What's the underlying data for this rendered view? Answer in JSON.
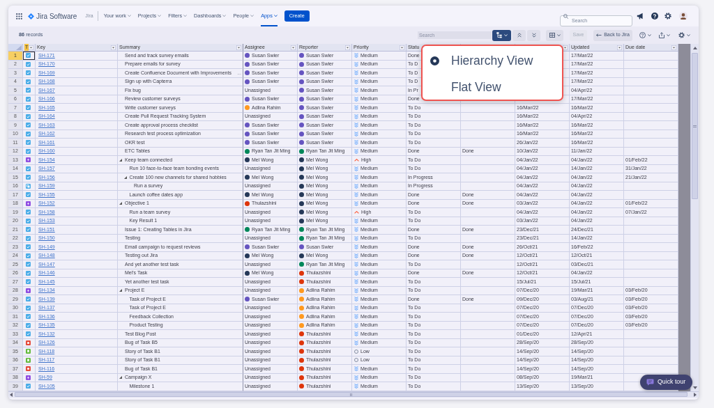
{
  "nav": {
    "product": "Jira Software",
    "site": "Jira",
    "items": [
      {
        "label": "Your work",
        "selected": false
      },
      {
        "label": "Projects",
        "selected": false
      },
      {
        "label": "Filters",
        "selected": false
      },
      {
        "label": "Dashboards",
        "selected": false
      },
      {
        "label": "People",
        "selected": false
      },
      {
        "label": "Apps",
        "selected": true
      }
    ],
    "create_button": "Create",
    "search": {
      "placeholder": "Search"
    }
  },
  "toolbar": {
    "records": "**86** records",
    "search": {
      "placeholder": "Search"
    },
    "view_button": {
      "open": true
    },
    "save_button": {
      "label": "Save",
      "disabled": true
    },
    "back_button": "Back to Jira"
  },
  "table": {
    "columns": [
      {
        "label": "T",
        "selected": true
      },
      {
        "label": "Key",
        "selected": false
      },
      {
        "label": "Summary",
        "selected": false
      },
      {
        "label": "Assignee",
        "selected": false
      },
      {
        "label": "Reporter",
        "selected": false
      },
      {
        "label": "Priority",
        "selected": false
      },
      {
        "label": "Statu",
        "selected": false
      },
      {
        "label": "Updated",
        "selected": false
      },
      {
        "label": "Due date",
        "selected": false
      }
    ],
    "rows": [
      {
        "num": "1",
        "selected": true,
        "kind": "task",
        "key": "SH-171",
        "summary": "Send and track survey emails",
        "assignee": {
          "name": "Susan Swier",
          "color": "#6554c0"
        },
        "reporter": {
          "name": "Susan Swier",
          "color": "#6554c0"
        },
        "priority": {
          "label": "Medium",
          "kind": "medium"
        },
        "status": "Done",
        "updated": "17/Mar/22"
      },
      {
        "num": "2",
        "selected": false,
        "kind": "task",
        "key": "SH-170",
        "summary": "Prepare emails for survey",
        "assignee": {
          "name": "Susan Swier",
          "color": "#6554c0"
        },
        "reporter": {
          "name": "Susan Swier",
          "color": "#6554c0"
        },
        "priority": {
          "label": "Medium",
          "kind": "medium"
        },
        "status": "To D",
        "updated": "17/Mar/22"
      },
      {
        "num": "3",
        "selected": false,
        "kind": "task",
        "key": "SH-169",
        "summary": "Create Confluence Document with Improvements",
        "note": "...",
        "assignee": {
          "name": "Susan Swier",
          "color": "#6554c0"
        },
        "reporter": {
          "name": "Susan Swier",
          "color": "#6554c0"
        },
        "priority": {
          "label": "Medium",
          "kind": "medium"
        },
        "status": "To D",
        "updated": "17/Mar/22"
      },
      {
        "num": "4",
        "selected": false,
        "kind": "task",
        "key": "SH-168",
        "summary": "Sign up with Capterra",
        "assignee": {
          "name": "Susan Swier",
          "color": "#6554c0"
        },
        "reporter": {
          "name": "Susan Swier",
          "color": "#6554c0"
        },
        "priority": {
          "label": "Medium",
          "kind": "medium"
        },
        "status": "To D",
        "updated": "17/Mar/22"
      },
      {
        "num": "5",
        "selected": false,
        "kind": "task",
        "key": "SH-167",
        "summary": "Fix bug",
        "assignee": {
          "name": "Unassigned"
        },
        "reporter": {
          "name": "Susan Swier",
          "color": "#6554c0"
        },
        "priority": {
          "label": "Medium",
          "kind": "medium"
        },
        "status": "In Pr",
        "updated": "04/Apr/22"
      },
      {
        "num": "6",
        "selected": false,
        "kind": "task",
        "key": "SH-166",
        "summary": "Review customer surveys",
        "assignee": {
          "name": "Susan Swier",
          "color": "#6554c0"
        },
        "reporter": {
          "name": "Susan Swier",
          "color": "#6554c0"
        },
        "priority": {
          "label": "Medium",
          "kind": "medium"
        },
        "status": "Done",
        "updated": "17/Mar/22"
      },
      {
        "num": "7",
        "selected": false,
        "kind": "task",
        "key": "SH-165",
        "summary": "Write customer surveys",
        "assignee": {
          "name": "Adlina Rahim",
          "color": "#ff991f"
        },
        "reporter": {
          "name": "Susan Swier",
          "color": "#6554c0"
        },
        "priority": {
          "label": "Medium",
          "kind": "medium"
        },
        "status": "To Do",
        "column_7": "16/Mar/22",
        "updated": "16/Mar/22"
      },
      {
        "num": "8",
        "selected": false,
        "kind": "task",
        "key": "SH-164",
        "summary": "Create Pull Request Tracking System",
        "assignee": {
          "name": "Unassigned"
        },
        "reporter": {
          "name": "Susan Swier",
          "color": "#6554c0"
        },
        "priority": {
          "label": "Medium",
          "kind": "medium"
        },
        "status": "To Do",
        "column_7": "16/Mar/22",
        "updated": "04/Apr/22"
      },
      {
        "num": "9",
        "selected": false,
        "kind": "task",
        "key": "SH-163",
        "summary": "Create approval process checklist",
        "assignee": {
          "name": "Susan Swier",
          "color": "#6554c0"
        },
        "reporter": {
          "name": "Susan Swier",
          "color": "#6554c0"
        },
        "priority": {
          "label": "Medium",
          "kind": "medium"
        },
        "status": "To Do",
        "column_7": "16/Mar/22",
        "updated": "16/Mar/22"
      },
      {
        "num": "10",
        "selected": false,
        "kind": "task",
        "key": "SH-162",
        "summary": "Research test process optimization",
        "assignee": {
          "name": "Susan Swier",
          "color": "#6554c0"
        },
        "reporter": {
          "name": "Susan Swier",
          "color": "#6554c0"
        },
        "priority": {
          "label": "Medium",
          "kind": "medium"
        },
        "status": "To Do",
        "column_7": "16/Mar/22",
        "updated": "16/Mar/22"
      },
      {
        "num": "11",
        "selected": false,
        "kind": "task",
        "key": "SH-161",
        "summary": "OKR test",
        "assignee": {
          "name": "Susan Swier",
          "color": "#6554c0"
        },
        "reporter": {
          "name": "Susan Swier",
          "color": "#6554c0"
        },
        "priority": {
          "label": "Medium",
          "kind": "medium"
        },
        "status": "To Do",
        "column_7": "26/Jan/22",
        "updated": "16/Mar/22"
      },
      {
        "num": "12",
        "selected": false,
        "kind": "task",
        "key": "SH-160",
        "summary": "ETC Tables",
        "assignee": {
          "name": "Ryan Tan Jit Ming",
          "color": "#00875a"
        },
        "reporter": {
          "name": "Ryan Tan Jit Ming",
          "color": "#00875a"
        },
        "priority": {
          "label": "Medium",
          "kind": "medium"
        },
        "status": "Done",
        "column_6": "Done",
        "column_7": "10/Jan/22",
        "updated": "11/Jan/22"
      },
      {
        "num": "13",
        "selected": false,
        "kind": "epic",
        "key": "SH-154",
        "summary": "Keep team connected",
        "expanded": true,
        "assignee": {
          "name": "Mel Wong",
          "color": "#253858"
        },
        "reporter": {
          "name": "Mel Wong",
          "color": "#253858"
        },
        "priority": {
          "label": "High",
          "kind": "high"
        },
        "status": "To Do",
        "column_7": "04/Jan/22",
        "updated": "04/Jan/22",
        "due_date": "01/Feb/22",
        "children": [
          {
            "num": "14",
            "selected": false,
            "kind": "task",
            "key": "SH-157",
            "summary": "Run 10 face-to-face team bonding events",
            "assignee": {
              "name": "Unassigned"
            },
            "reporter": {
              "name": "Mel Wong",
              "color": "#253858"
            },
            "priority": {
              "label": "Medium",
              "kind": "medium"
            },
            "status": "To Do",
            "column_7": "04/Jan/22",
            "updated": "14/Jan/22",
            "due_date": "31/Jan/22"
          },
          {
            "num": "15",
            "selected": false,
            "kind": "task",
            "key": "SH-156",
            "summary": "Create 100 new channels for shared hobbies",
            "expanded": true,
            "assignee": {
              "name": "Mel Wong",
              "color": "#253858"
            },
            "reporter": {
              "name": "Mel Wong",
              "color": "#253858"
            },
            "priority": {
              "label": "Medium",
              "kind": "medium"
            },
            "status": "In Progress",
            "column_7": "04/Jan/22",
            "updated": "04/Jan/22",
            "due_date": "21/Jan/22",
            "children": [
              {
                "num": "16",
                "selected": false,
                "kind": "subtask",
                "key": "SH-159",
                "summary": "Run a survey",
                "assignee": {
                  "name": "Unassigned"
                },
                "reporter": {
                  "name": "Mel Wong",
                  "color": "#253858"
                },
                "priority": {
                  "label": "Medium",
                  "kind": "medium"
                },
                "status": "In Progress",
                "column_7": "04/Jan/22",
                "updated": "04/Jan/22"
              }
            ]
          },
          {
            "num": "17",
            "selected": false,
            "kind": "task",
            "key": "SH-155",
            "summary": "Launch coffee dates app",
            "assignee": {
              "name": "Mel Wong",
              "color": "#253858"
            },
            "reporter": {
              "name": "Mel Wong",
              "color": "#253858"
            },
            "priority": {
              "label": "Medium",
              "kind": "medium"
            },
            "status": "Done",
            "column_6": "Done",
            "column_7": "04/Jan/22",
            "updated": "04/Jan/22"
          }
        ]
      },
      {
        "num": "18",
        "selected": false,
        "kind": "epic",
        "key": "SH-152",
        "summary": "Objective 1",
        "expanded": true,
        "assignee": {
          "name": "Thulazshini",
          "color": "#de350b"
        },
        "reporter": {
          "name": "Mel Wong",
          "color": "#253858"
        },
        "priority": {
          "label": "Medium",
          "kind": "medium"
        },
        "status": "Done",
        "column_6": "Done",
        "column_7": "03/Jan/22",
        "updated": "04/Jan/22",
        "due_date": "01/Feb/22",
        "children": [
          {
            "num": "19",
            "selected": false,
            "kind": "task",
            "key": "SH-158",
            "summary": "Run a team survey",
            "assignee": {
              "name": "Unassigned"
            },
            "reporter": {
              "name": "Mel Wong",
              "color": "#253858"
            },
            "priority": {
              "label": "High",
              "kind": "high"
            },
            "status": "To Do",
            "column_7": "04/Jan/22",
            "updated": "04/Jan/22",
            "due_date": "07/Jan/22"
          },
          {
            "num": "20",
            "selected": false,
            "kind": "task",
            "key": "SH-153",
            "summary": "Key Result 1",
            "assignee": {
              "name": "Unassigned"
            },
            "reporter": {
              "name": "Mel Wong",
              "color": "#253858"
            },
            "priority": {
              "label": "Medium",
              "kind": "medium"
            },
            "status": "To Do",
            "column_7": "03/Jan/22",
            "updated": "04/Jan/22"
          }
        ]
      },
      {
        "num": "21",
        "selected": false,
        "kind": "task",
        "key": "SH-151",
        "summary": "Issue 1: Creating Tables in Jira",
        "assignee": {
          "name": "Ryan Tan Jit Ming",
          "color": "#00875a"
        },
        "reporter": {
          "name": "Ryan Tan Jit Ming",
          "color": "#00875a"
        },
        "priority": {
          "label": "Medium",
          "kind": "medium"
        },
        "status": "Done",
        "column_6": "Done",
        "column_7": "23/Dec/21",
        "updated": "24/Dec/21"
      },
      {
        "num": "22",
        "selected": false,
        "kind": "task",
        "key": "SH-150",
        "summary": "Testing",
        "assignee": {
          "name": "Unassigned"
        },
        "reporter": {
          "name": "Ryan Tan Jit Ming",
          "color": "#00875a"
        },
        "priority": {
          "label": "Medium",
          "kind": "medium"
        },
        "status": "To Do",
        "column_7": "23/Dec/21",
        "updated": "14/Jan/22"
      },
      {
        "num": "23",
        "selected": false,
        "kind": "task",
        "key": "SH-149",
        "summary": "Email campaign to request reviews",
        "assignee": {
          "name": "Susan Swier",
          "color": "#6554c0"
        },
        "reporter": {
          "name": "Susan Swier",
          "color": "#6554c0"
        },
        "priority": {
          "label": "Medium",
          "kind": "medium"
        },
        "status": "Done",
        "column_6": "Done",
        "column_7": "26/Oct/21",
        "updated": "16/Feb/22"
      },
      {
        "num": "24",
        "selected": false,
        "kind": "task",
        "key": "SH-148",
        "summary": "Testing out Jira",
        "assignee": {
          "name": "Mel Wong",
          "color": "#253858"
        },
        "reporter": {
          "name": "Mel Wong",
          "color": "#253858"
        },
        "priority": {
          "label": "Medium",
          "kind": "medium"
        },
        "status": "Done",
        "column_6": "Done",
        "column_7": "12/Oct/21",
        "updated": "12/Oct/21"
      },
      {
        "num": "25",
        "selected": false,
        "kind": "task",
        "key": "SH-147",
        "summary": "And yet another test task",
        "assignee": {
          "name": "Unassigned"
        },
        "reporter": {
          "name": "Ryan Tan Jit Ming",
          "color": "#00875a"
        },
        "priority": {
          "label": "Medium",
          "kind": "medium"
        },
        "status": "To Do",
        "column_7": "12/Oct/21",
        "updated": "03/Dec/21"
      },
      {
        "num": "26",
        "selected": false,
        "kind": "task",
        "key": "SH-146",
        "summary": "Mel's Task",
        "assignee": {
          "name": "Mel Wong",
          "color": "#253858"
        },
        "reporter": {
          "name": "Thulazshini",
          "color": "#de350b"
        },
        "priority": {
          "label": "Medium",
          "kind": "medium"
        },
        "status": "Done",
        "column_6": "Done",
        "column_7": "12/Oct/21",
        "updated": "04/Jan/22"
      },
      {
        "num": "27",
        "selected": false,
        "kind": "task",
        "key": "SH-145",
        "summary": "Yet another test task",
        "assignee": {
          "name": "Unassigned"
        },
        "reporter": {
          "name": "Thulazshini",
          "color": "#de350b"
        },
        "priority": {
          "label": "Medium",
          "kind": "medium"
        },
        "status": "To Do",
        "column_7": "15/Jul/21",
        "updated": "15/Jul/21"
      },
      {
        "num": "28",
        "selected": false,
        "kind": "epic",
        "key": "SH-134",
        "summary": "Project E",
        "expanded": true,
        "assignee": {
          "name": "Unassigned"
        },
        "reporter": {
          "name": "Adlina Rahim",
          "color": "#ff991f"
        },
        "priority": {
          "label": "Medium",
          "kind": "medium"
        },
        "status": "To Do",
        "column_7": "07/Dec/20",
        "updated": "19/Mar/21",
        "due_date": "03/Feb/20",
        "children": [
          {
            "num": "29",
            "selected": false,
            "kind": "task",
            "key": "SH-139",
            "summary": "Task of Project E",
            "assignee": {
              "name": "Susan Swier",
              "color": "#6554c0"
            },
            "reporter": {
              "name": "Adlina Rahim",
              "color": "#ff991f"
            },
            "priority": {
              "label": "Medium",
              "kind": "medium"
            },
            "status": "Done",
            "column_6": "Done",
            "column_7": "09/Dec/20",
            "updated": "03/Aug/21",
            "due_date": "03/Feb/20"
          },
          {
            "num": "30",
            "selected": false,
            "kind": "task",
            "key": "SH-137",
            "summary": "Task of Project E",
            "assignee": {
              "name": "Unassigned"
            },
            "reporter": {
              "name": "Adlina Rahim",
              "color": "#ff991f"
            },
            "priority": {
              "label": "Medium",
              "kind": "medium"
            },
            "status": "To Do",
            "column_7": "07/Dec/20",
            "updated": "07/Dec/20",
            "due_date": "03/Feb/20"
          },
          {
            "num": "31",
            "selected": false,
            "kind": "task",
            "key": "SH-136",
            "summary": "Feedback Collection",
            "assignee": {
              "name": "Unassigned"
            },
            "reporter": {
              "name": "Adlina Rahim",
              "color": "#ff991f"
            },
            "priority": {
              "label": "Medium",
              "kind": "medium"
            },
            "status": "To Do",
            "column_7": "07/Dec/20",
            "updated": "07/Dec/20",
            "due_date": "03/Feb/20"
          },
          {
            "num": "32",
            "selected": false,
            "kind": "task",
            "key": "SH-135",
            "summary": "Product Testing",
            "assignee": {
              "name": "Unassigned"
            },
            "reporter": {
              "name": "Adlina Rahim",
              "color": "#ff991f"
            },
            "priority": {
              "label": "Medium",
              "kind": "medium"
            },
            "status": "To Do",
            "column_7": "07/Dec/20",
            "updated": "07/Dec/20",
            "due_date": "03/Feb/20"
          }
        ]
      },
      {
        "num": "33",
        "selected": false,
        "kind": "task",
        "key": "SH-132",
        "summary": "Test Blog Post",
        "assignee": {
          "name": "Unassigned"
        },
        "reporter": {
          "name": "Thulazshini",
          "color": "#de350b"
        },
        "priority": {
          "label": "Medium",
          "kind": "medium"
        },
        "status": "To Do",
        "column_7": "01/Dec/20",
        "updated": "12/Apr/21"
      },
      {
        "num": "34",
        "selected": false,
        "kind": "bug",
        "key": "SH-126",
        "summary": "Bug of Task B5",
        "assignee": {
          "name": "Unassigned"
        },
        "reporter": {
          "name": "Thulazshini",
          "color": "#de350b"
        },
        "priority": {
          "label": "Medium",
          "kind": "medium"
        },
        "status": "To Do",
        "column_7": "28/Sep/20",
        "updated": "28/Sep/20"
      },
      {
        "num": "35",
        "selected": false,
        "kind": "story",
        "key": "SH-118",
        "summary": "Story of Task B1",
        "assignee": {
          "name": "Unassigned"
        },
        "reporter": {
          "name": "Thulazshini",
          "color": "#de350b"
        },
        "priority": {
          "label": "Low",
          "kind": "low"
        },
        "status": "To Do",
        "column_7": "14/Sep/20",
        "updated": "14/Sep/20"
      },
      {
        "num": "36",
        "selected": false,
        "kind": "story",
        "key": "SH-117",
        "summary": "Story of Task B1",
        "assignee": {
          "name": "Unassigned"
        },
        "reporter": {
          "name": "Thulazshini",
          "color": "#de350b"
        },
        "priority": {
          "label": "Low",
          "kind": "low"
        },
        "status": "To Do",
        "column_7": "14/Sep/20",
        "updated": "14/Sep/20"
      },
      {
        "num": "37",
        "selected": false,
        "kind": "bug",
        "key": "SH-116",
        "summary": "Bug of Task B1",
        "assignee": {
          "name": "Unassigned"
        },
        "reporter": {
          "name": "Thulazshini",
          "color": "#de350b"
        },
        "priority": {
          "label": "Medium",
          "kind": "medium"
        },
        "status": "To Do",
        "column_7": "14/Sep/20",
        "updated": "14/Sep/20"
      },
      {
        "num": "38",
        "selected": false,
        "kind": "epic",
        "key": "SH-59",
        "summary": "Campaign X",
        "expanded": true,
        "assignee": {
          "name": "Unassigned"
        },
        "reporter": {
          "name": "Thulazshini",
          "color": "#de350b"
        },
        "priority": {
          "label": "Medium",
          "kind": "medium"
        },
        "status": "To Do",
        "column_7": "08/Sep/20",
        "updated": "19/Mar/21",
        "children": [
          {
            "num": "39",
            "selected": false,
            "kind": "task",
            "key": "SH-105",
            "summary": "Milestone 1",
            "assignee": {
              "name": "Unassigned"
            },
            "reporter": {
              "name": "Thulazshini",
              "color": "#de350b"
            },
            "priority": {
              "label": "Medium",
              "kind": "medium"
            },
            "status": "To Do",
            "column_7": "13/Sep/20",
            "updated": "13/Sep/20"
          }
        ]
      }
    ]
  },
  "view_menu": {
    "options": [
      {
        "label": "Hierarchy View",
        "selected": true
      },
      {
        "label": "Flat View",
        "selected": false
      }
    ]
  },
  "quick_tour": {
    "label": "Quick tour"
  }
}
